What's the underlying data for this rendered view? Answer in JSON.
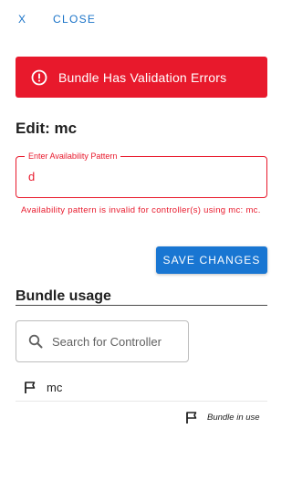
{
  "header": {
    "close_x": "X",
    "close_label": "CLOSE"
  },
  "error_banner": {
    "icon": "alert-circle-icon",
    "message": "Bundle Has Validation Errors",
    "color": "#e8192c"
  },
  "edit": {
    "title": "Edit: mc",
    "pattern_field": {
      "label": "Enter Availability Pattern",
      "value": "d"
    },
    "helper_text": "Availability pattern is invalid for controller(s) using mc: mc.",
    "save_label": "SAVE CHANGES",
    "accent_color": "#1976d2"
  },
  "usage": {
    "title": "Bundle usage",
    "search_placeholder": "Search for Controller",
    "controllers": [
      {
        "icon": "flag-icon",
        "label": "mc"
      }
    ],
    "legend": {
      "icon": "flag-icon",
      "label": "Bundle in use"
    }
  }
}
